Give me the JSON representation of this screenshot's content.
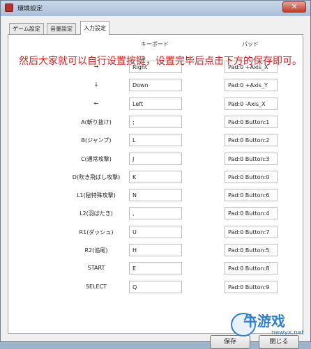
{
  "window": {
    "title": "環境設定",
    "close_glyph": "✕"
  },
  "tabs": [
    {
      "label": "ゲーム設定"
    },
    {
      "label": "音量設定"
    },
    {
      "label": "入力設定"
    }
  ],
  "columns": {
    "keyboard": "キーボード",
    "pad": "パッド"
  },
  "overlay_note": "然后大家就可以自行设置按键，设置完毕后点击下方的保存即可。",
  "rows": [
    {
      "label": "→",
      "key": "Right",
      "pad": "Pad:0 +Axis_X"
    },
    {
      "label": "↓",
      "key": "Down",
      "pad": "Pad:0 +Axis_Y"
    },
    {
      "label": "←",
      "key": "Left",
      "pad": "Pad:0 -Axis_X"
    },
    {
      "label": "A(斬り抜け)",
      "key": ";",
      "pad": "Pad:0 Button:1"
    },
    {
      "label": "B(ジャンプ)",
      "key": "L",
      "pad": "Pad:0 Button:2"
    },
    {
      "label": "C(通常攻撃)",
      "key": "J",
      "pad": "Pad:0 Button:3"
    },
    {
      "label": "D(吹き飛ばし攻撃)",
      "key": "K",
      "pad": "Pad:0 Button:0"
    },
    {
      "label": "L1(秘特殊攻撃)",
      "key": "N",
      "pad": "Pad:0 Button:6"
    },
    {
      "label": "L2(羽ばたき)",
      "key": ",",
      "pad": "Pad:0 Button:4"
    },
    {
      "label": "R1(ダッシュ)",
      "key": "U",
      "pad": "Pad:0 Button:7"
    },
    {
      "label": "R2(追尾)",
      "key": "H",
      "pad": "Pad:0 Button:5"
    },
    {
      "label": "START",
      "key": "E",
      "pad": "Pad:0 Button:8"
    },
    {
      "label": "SELECT",
      "key": "Q",
      "pad": "Pad:0 Button:9"
    }
  ],
  "buttons": {
    "save": "保存",
    "close": "閉じる"
  },
  "watermark": {
    "text": "牛游戏",
    "sub": "newyx.net"
  }
}
